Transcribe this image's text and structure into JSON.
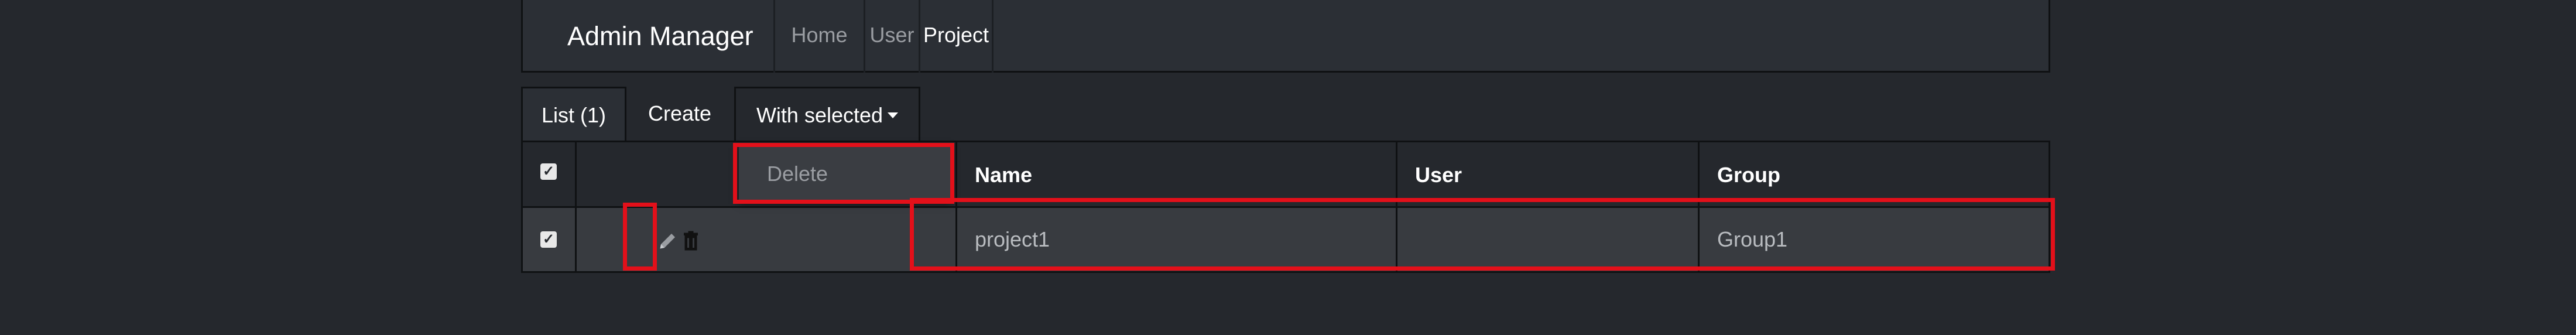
{
  "navbar": {
    "brand": "Admin Manager",
    "items": [
      {
        "label": "Home"
      },
      {
        "label": "User"
      },
      {
        "label": "Project"
      }
    ]
  },
  "tabs": [
    {
      "label": "List (1)"
    },
    {
      "label": "Create"
    },
    {
      "label": "With selected"
    }
  ],
  "dropdown": {
    "items": [
      {
        "label": "Delete"
      }
    ]
  },
  "table": {
    "columns": [
      "",
      "",
      "Name",
      "User",
      "Group"
    ],
    "rows": [
      {
        "name": "project1",
        "user": "",
        "group": "Group1",
        "checked": true
      }
    ],
    "header_checked": true
  },
  "icons": {
    "edit": "pencil-icon",
    "delete": "trash-icon",
    "caret": "caret-down-icon"
  },
  "colors": {
    "background": "#25282d",
    "highlight": "#e3101a",
    "row_background": "#383b40"
  }
}
